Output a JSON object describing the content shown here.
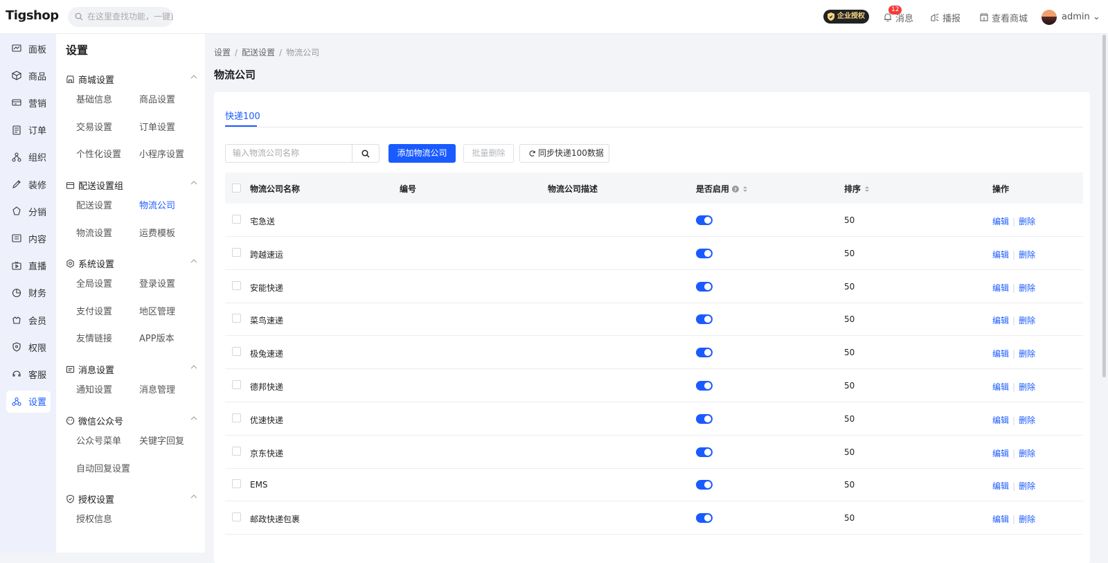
{
  "brand": {
    "logo": "Tigshop"
  },
  "topbar": {
    "search_placeholder": "在这里查找功能，一键直达",
    "auth_label": "企业授权",
    "messages_label": "消息",
    "messages_badge": "12",
    "broadcast_label": "播报",
    "view_shop_label": "查看商城",
    "user_name": "admin"
  },
  "rail": {
    "items": [
      {
        "label": "面板",
        "icon": "dashboard-icon"
      },
      {
        "label": "商品",
        "icon": "box-icon"
      },
      {
        "label": "营销",
        "icon": "marketing-icon"
      },
      {
        "label": "订单",
        "icon": "order-icon"
      },
      {
        "label": "组织",
        "icon": "org-icon"
      },
      {
        "label": "装修",
        "icon": "decorate-icon"
      },
      {
        "label": "分销",
        "icon": "distribution-icon"
      },
      {
        "label": "内容",
        "icon": "content-icon"
      },
      {
        "label": "直播",
        "icon": "live-icon"
      },
      {
        "label": "财务",
        "icon": "finance-icon"
      },
      {
        "label": "会员",
        "icon": "member-icon"
      },
      {
        "label": "权限",
        "icon": "shield-icon"
      },
      {
        "label": "客服",
        "icon": "service-icon"
      },
      {
        "label": "设置",
        "icon": "settings-icon"
      }
    ],
    "active_index": 13
  },
  "submenu": {
    "title": "设置",
    "groups": [
      {
        "label": "商城设置",
        "links": [
          "基础信息",
          "商品设置",
          "交易设置",
          "订单设置",
          "个性化设置",
          "小程序设置"
        ]
      },
      {
        "label": "配送设置组",
        "links": [
          "配送设置",
          "物流公司",
          "物流设置",
          "运费模板"
        ]
      },
      {
        "label": "系统设置",
        "links": [
          "全局设置",
          "登录设置",
          "支付设置",
          "地区管理",
          "友情链接",
          "APP版本"
        ]
      },
      {
        "label": "消息设置",
        "links": [
          "通知设置",
          "消息管理"
        ]
      },
      {
        "label": "微信公众号",
        "links": [
          "公众号菜单",
          "关键字回复",
          "自动回复设置"
        ]
      },
      {
        "label": "授权设置",
        "links": [
          "授权信息"
        ]
      }
    ],
    "active_link": "物流公司"
  },
  "breadcrumb": [
    "设置",
    "配送设置",
    "物流公司"
  ],
  "page_title": "物流公司",
  "tabs": [
    "快递100"
  ],
  "toolbar": {
    "search_placeholder": "输入物流公司名称",
    "add_label": "添加物流公司",
    "batch_delete_label": "批量删除",
    "sync_label": "同步快递100数据"
  },
  "table": {
    "columns": [
      "物流公司名称",
      "编号",
      "物流公司描述",
      "是否启用",
      "排序",
      "操作"
    ],
    "rows": [
      {
        "name": "宅急送",
        "code": "",
        "desc": "",
        "enabled": true,
        "sort": "50"
      },
      {
        "name": "跨越速运",
        "code": "",
        "desc": "",
        "enabled": true,
        "sort": "50"
      },
      {
        "name": "安能快递",
        "code": "",
        "desc": "",
        "enabled": true,
        "sort": "50"
      },
      {
        "name": "菜鸟速递",
        "code": "",
        "desc": "",
        "enabled": true,
        "sort": "50"
      },
      {
        "name": "极兔速递",
        "code": "",
        "desc": "",
        "enabled": true,
        "sort": "50"
      },
      {
        "name": "德邦快递",
        "code": "",
        "desc": "",
        "enabled": true,
        "sort": "50"
      },
      {
        "name": "优速快递",
        "code": "",
        "desc": "",
        "enabled": true,
        "sort": "50"
      },
      {
        "name": "京东快递",
        "code": "",
        "desc": "",
        "enabled": true,
        "sort": "50"
      },
      {
        "name": "EMS",
        "code": "",
        "desc": "",
        "enabled": true,
        "sort": "50"
      },
      {
        "name": "邮政快递包裹",
        "code": "",
        "desc": "",
        "enabled": true,
        "sort": "50"
      }
    ],
    "edit_label": "编辑",
    "delete_label": "删除"
  },
  "colors": {
    "primary": "#1a5bff",
    "rail_bg": "#eef0fb",
    "page_bg": "#f3f4f8"
  }
}
